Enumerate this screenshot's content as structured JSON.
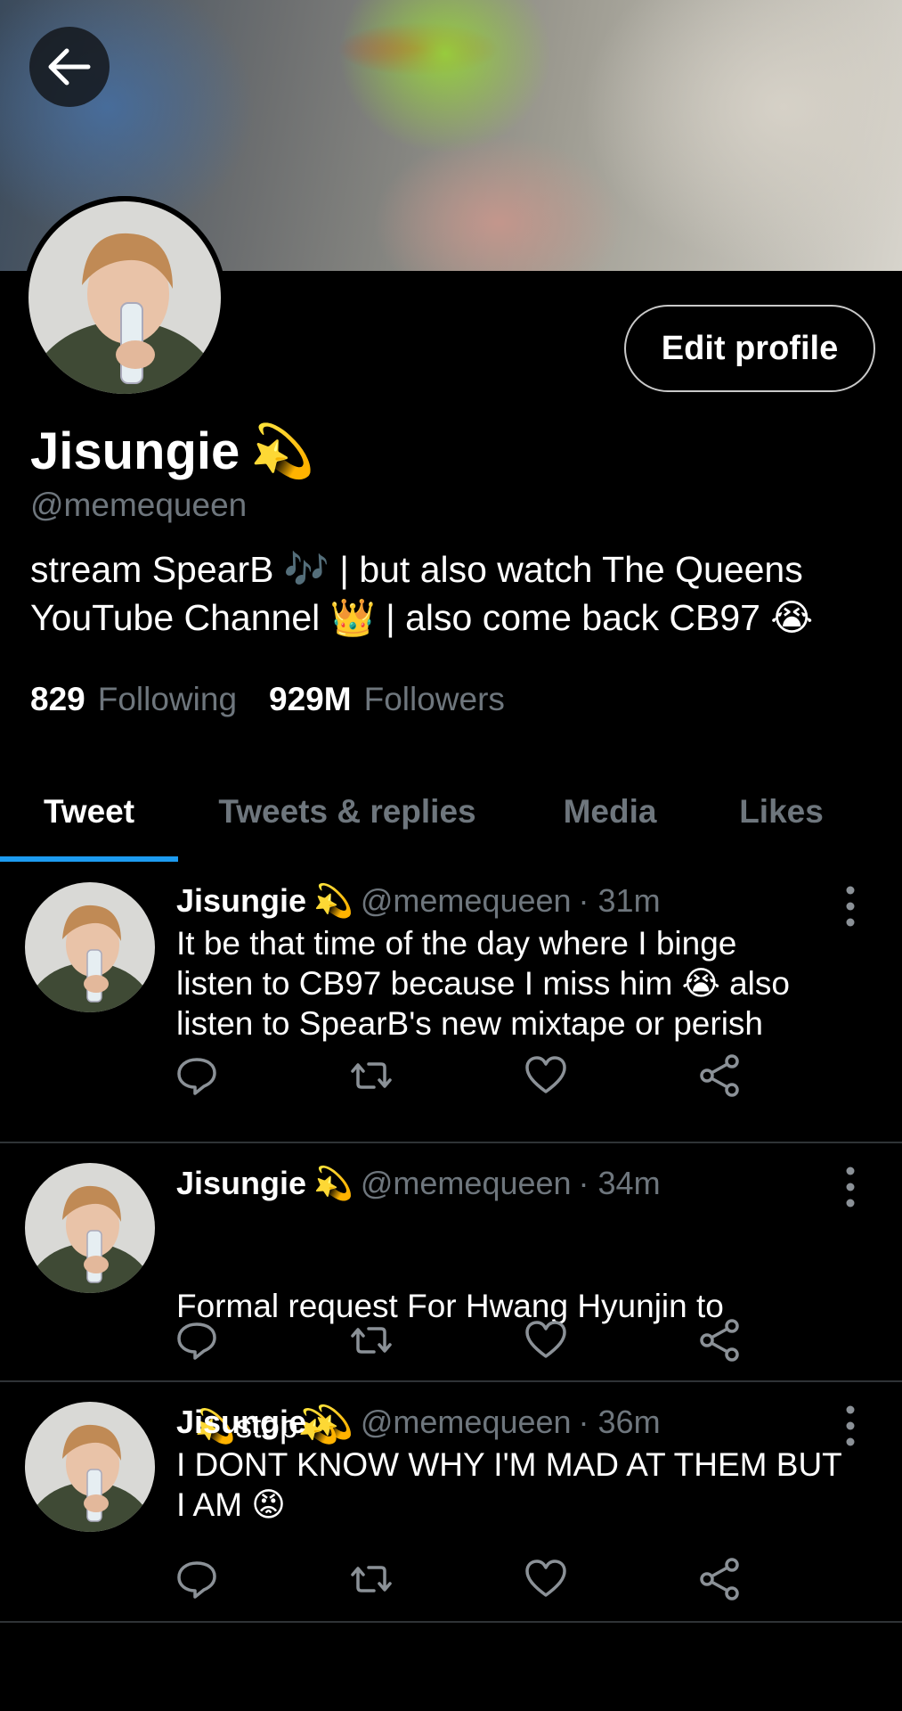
{
  "nav": {
    "back_icon": "arrow-left-icon"
  },
  "profile": {
    "name": "Jisungie",
    "name_emoji": "💫",
    "handle": "@memequeen",
    "bio_line1": "stream SpearB 🎶 | but also watch The Queens",
    "bio_line2": "YouTube Channel 👑 | also come back CB97 😭",
    "following_count": "829",
    "following_label": "Following",
    "followers_count": "929M",
    "followers_label": "Followers",
    "edit_button": "Edit profile"
  },
  "tabs": [
    {
      "label": "Tweet",
      "active": true
    },
    {
      "label": "Tweets & replies",
      "active": false
    },
    {
      "label": "Media",
      "active": false
    },
    {
      "label": "Likes",
      "active": false
    }
  ],
  "tweets": [
    {
      "name": "Jisungie",
      "emoji": "💫",
      "handle": "@memequeen",
      "time": "· 31m",
      "line1": "It be that time of the day where I binge",
      "line2": "listen to CB97 because I miss him 😭 also",
      "line3": "listen to SpearB's new mixtape or perish"
    },
    {
      "name": "Jisungie",
      "emoji": "💫",
      "handle": "@memequeen",
      "time": "· 34m",
      "line1": "Formal request For Hwang Hyunjin to",
      "line2": "  💫stop💫",
      "line3": ""
    },
    {
      "name": "Jisungie",
      "emoji": "💫",
      "handle": "@memequeen",
      "time": "· 36m",
      "line1": "I DONT KNOW WHY I'M MAD AT THEM BUT",
      "line2": "I AM 😡",
      "line3": ""
    }
  ],
  "colors": {
    "background": "#000000",
    "accent": "#1d9bf0",
    "secondary_text": "#6e767d",
    "divider": "#2f3336"
  }
}
